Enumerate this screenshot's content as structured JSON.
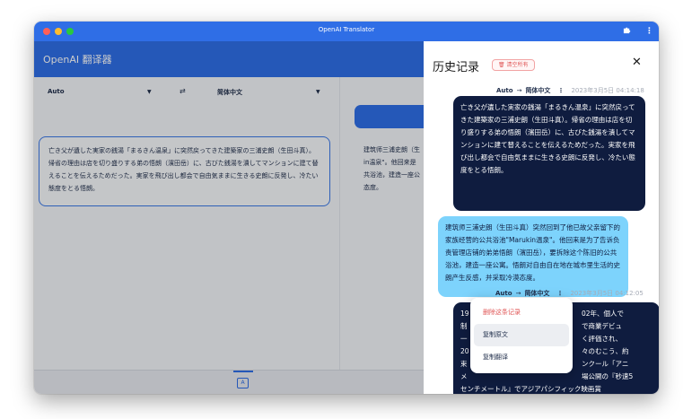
{
  "window": {
    "title": "OpenAI Translator"
  },
  "app": {
    "title": "OpenAI 翻译器"
  },
  "translator": {
    "source_lang": "Auto",
    "target_lang": "简体中文",
    "source_text": "亡き父が遺した実家の銭湯「まるきん温泉」に突然戻ってきた建築家の三浦史朗（生田斗真）。帰省の理由は店を切り盛りする弟の悟朗（濱田岳）に、古びた銭湯を潰してマンションに建て替えることを伝えるためだった。実家を飛び出し都会で自由気ままに生きる史朗に反発し、冷たい態度をとる悟朗。",
    "target_lines": [
      "建筑师三浦史朗（生",
      "in温泉\"。他回来是",
      "共浴池，建造一座公",
      "态度。"
    ]
  },
  "history": {
    "title": "历史记录",
    "clear_label": "清空所有",
    "records": [
      {
        "source_lang": "Auto",
        "target_lang": "简体中文",
        "time": "2023年3月5日 04:14:18",
        "original": "亡き父が遺した実家の銭湯「まるきん温泉」に突然戻ってきた建築家の三浦史朗（生田斗真）。帰省の理由は店を切り盛りする弟の悟朗（濱田岳）に、古びた銭湯を潰してマンションに建て替えることを伝えるためだった。実家を飛び出し都会で自由気ままに生きる史朗に反発し、冷たい態度をとる悟朗。",
        "translation": "建筑师三浦史朗（生田斗真）突然回到了他已故父亲留下的家族经营的公共浴池\"Marukin温泉\"。他回来是为了告诉负责管理店铺的弟弟悟朗（濱田岳），要拆除这个陈旧的公共浴池，建造一座公寓。悟朗对自由自在地在城市里生活的史朗产生反感，并采取冷漠态度。"
      },
      {
        "source_lang": "Auto",
        "target_lang": "简体中文",
        "time": "2023年3月5日 04:12:05",
        "original_lines": [
          "19",
          "制",
          "一",
          "20",
          "束",
          "メ",
          "センチメートル』でアジアパシフィック映画賞"
        ],
        "original_right_lines": [
          "02年、個人で",
          "で商業デビュ",
          "く評価され、",
          "々のむこう、約",
          "ンクール「アニ",
          "場公開の『秒速5"
        ]
      }
    ]
  },
  "context_menu": {
    "items": [
      {
        "label": "删除这条记录",
        "style": "danger"
      },
      {
        "label": "复制原文",
        "style": "active"
      },
      {
        "label": "复制翻译",
        "style": "normal"
      }
    ]
  },
  "bottom": {
    "translate_glyph": "A"
  },
  "icons": {
    "extension": "puzzle-icon",
    "more": "more-vertical-icon",
    "close": "close-icon",
    "swap": "swap-icon",
    "trash": "trash-icon"
  },
  "colors": {
    "accent": "#2f6ee6",
    "bubble_dark": "#0f1c3f",
    "bubble_light": "#7dd3fc",
    "danger": "#e05656"
  }
}
